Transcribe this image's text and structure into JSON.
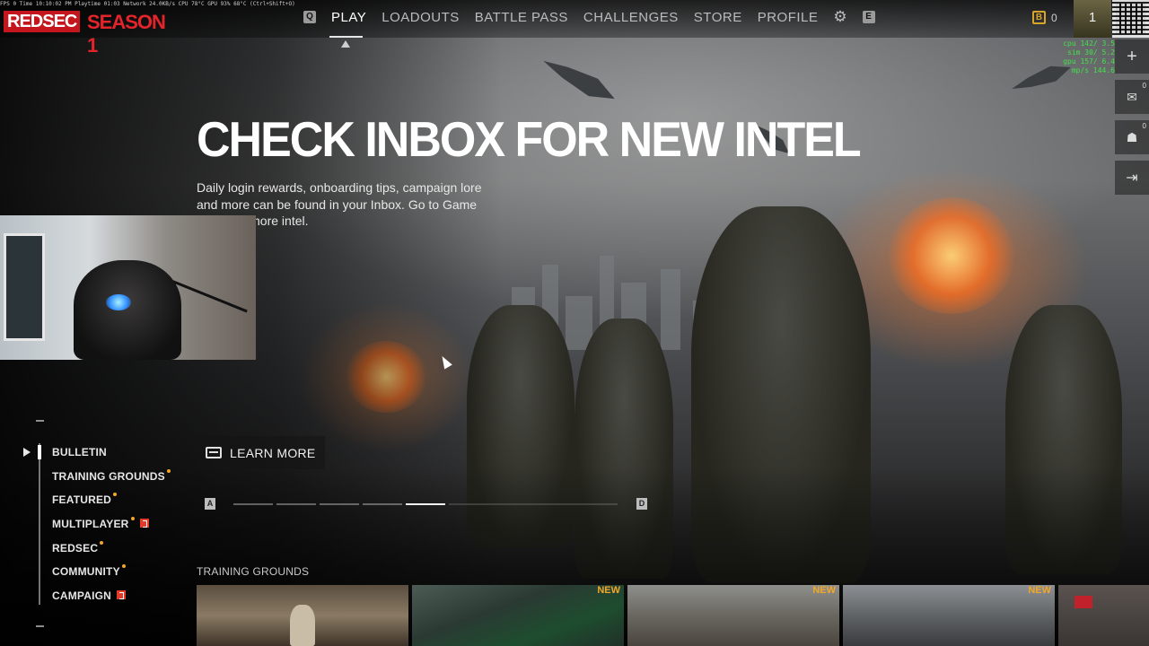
{
  "brand": {
    "logo_text": "REDSEC",
    "season": "SEASON 1"
  },
  "perf_overlay": "FPS 0   Time 10:10:02 PM   Playtime 01:03   Network 24.0KB/s   CPU 78°C   GPU 93% 68°C   (Ctrl+Shift+O)",
  "nav": {
    "left_key": "Q",
    "tabs": [
      "PLAY",
      "LOADOUTS",
      "BATTLE PASS",
      "CHALLENGES",
      "STORE",
      "PROFILE"
    ],
    "active_tab": "PLAY",
    "right_key": "E"
  },
  "currency": {
    "value": "0"
  },
  "rank": {
    "level": "1"
  },
  "cpu_overlay": [
    "cpu 142/ 3.5",
    "sim  30/ 5.2",
    "gpu 157/ 6.4",
    "mp/s 144.6"
  ],
  "right_rail": [
    {
      "icon": "plus-icon",
      "glyph": "+",
      "count": ""
    },
    {
      "icon": "mail-icon",
      "glyph": "✉",
      "count": "0"
    },
    {
      "icon": "friends-icon",
      "glyph": "☗",
      "count": "0"
    },
    {
      "icon": "exit-icon",
      "glyph": "⇥",
      "count": ""
    }
  ],
  "hero": {
    "title": "CHECK INBOX FOR NEW INTEL",
    "body": "Daily login rewards, onboarding tips, campaign lore and more can be found in your Inbox. Go to Game Menu for more intel.",
    "learn_more": "LEARN MORE"
  },
  "pager": {
    "prev_key": "A",
    "next_key": "D",
    "pages": 5,
    "active_page": 5
  },
  "categories": [
    {
      "label": "BULLETIN",
      "marker": ""
    },
    {
      "label": "TRAINING GROUNDS",
      "marker": "dot"
    },
    {
      "label": "FEATURED",
      "marker": "dot"
    },
    {
      "label": "MULTIPLAYER",
      "marker": "dot-badge"
    },
    {
      "label": "REDSEC",
      "marker": "dot"
    },
    {
      "label": "COMMUNITY",
      "marker": "dot"
    },
    {
      "label": "CAMPAIGN",
      "marker": "badge"
    }
  ],
  "section": {
    "label": "TRAINING GROUNDS"
  },
  "thumbnails": [
    {
      "name": "range",
      "badge": ""
    },
    {
      "name": "cockpit",
      "badge": "NEW"
    },
    {
      "name": "battlefield",
      "badge": "NEW"
    },
    {
      "name": "vehicle",
      "badge": "NEW"
    },
    {
      "name": "partial",
      "badge": ""
    }
  ],
  "colors": {
    "brand_red": "#c4161c",
    "accent_orange": "#f2a72b",
    "overlay_green": "#45e04a"
  }
}
